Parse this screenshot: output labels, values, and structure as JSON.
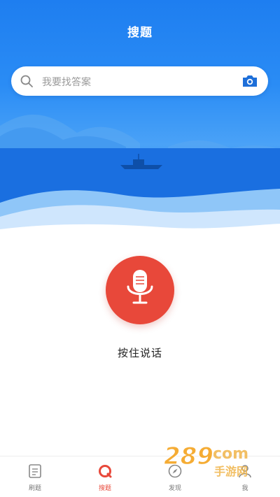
{
  "header": {
    "title": "搜题"
  },
  "search": {
    "placeholder": "我要找答案",
    "icon": "search-icon",
    "camera_icon": "camera-icon"
  },
  "voice": {
    "label": "按住说话",
    "icon": "microphone-icon",
    "color": "#e8483a"
  },
  "tabs": [
    {
      "label": "刷题",
      "icon": "document-icon",
      "active": false
    },
    {
      "label": "搜题",
      "icon": "search-tab-icon",
      "active": true
    },
    {
      "label": "发现",
      "icon": "compass-icon",
      "active": false
    },
    {
      "label": "我",
      "icon": "person-icon",
      "active": false
    }
  ],
  "watermark": {
    "brand": "289",
    "domain": "com",
    "subtitle": "手游网"
  },
  "colors": {
    "primary_blue": "#1e7ef0",
    "accent_red": "#e8483a"
  }
}
